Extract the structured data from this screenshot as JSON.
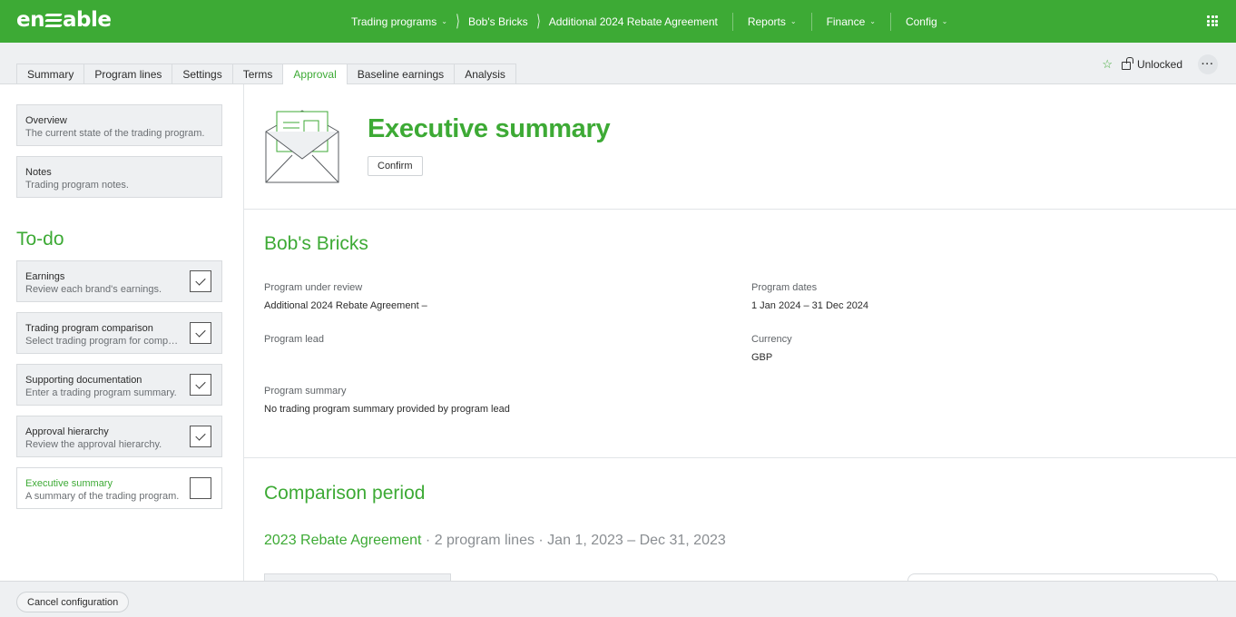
{
  "brand": {
    "logo_text_left": "en",
    "logo_text_right": "able"
  },
  "nav": {
    "trading_programs": "Trading programs",
    "crumb_supplier": "Bob's Bricks",
    "crumb_agreement": "Additional 2024 Rebate Agreement",
    "reports": "Reports",
    "finance": "Finance",
    "config": "Config"
  },
  "tabs": [
    {
      "label": "Summary"
    },
    {
      "label": "Program lines"
    },
    {
      "label": "Settings"
    },
    {
      "label": "Terms"
    },
    {
      "label": "Approval"
    },
    {
      "label": "Baseline earnings"
    },
    {
      "label": "Analysis"
    }
  ],
  "active_tab": "Approval",
  "lock_status": "Unlocked",
  "sidebar": {
    "overview": {
      "title": "Overview",
      "subtitle": "The current state of the trading program."
    },
    "notes": {
      "title": "Notes",
      "subtitle": "Trading program notes."
    },
    "todo_title": "To-do",
    "todo_items": [
      {
        "title": "Earnings",
        "subtitle": "Review each brand's earnings.",
        "checked": true
      },
      {
        "title": "Trading program comparison",
        "subtitle": "Select trading program for comparison.",
        "checked": true
      },
      {
        "title": "Supporting documentation",
        "subtitle": "Enter a trading program summary.",
        "checked": true
      },
      {
        "title": "Approval hierarchy",
        "subtitle": "Review the approval hierarchy.",
        "checked": true
      },
      {
        "title": "Executive summary",
        "subtitle": "A summary of the trading program.",
        "checked": false
      }
    ]
  },
  "main": {
    "title": "Executive summary",
    "confirm_label": "Confirm",
    "supplier_name": "Bob's Bricks",
    "fields": {
      "program_under_review_label": "Program under review",
      "program_under_review_value": "Additional 2024 Rebate Agreement –",
      "program_dates_label": "Program dates",
      "program_dates_value": "1 Jan 2024 – 31 Dec 2024",
      "program_lead_label": "Program lead",
      "program_lead_value": "",
      "currency_label": "Currency",
      "currency_value": "GBP",
      "program_summary_label": "Program summary",
      "program_summary_value": "No trading program summary provided by program lead"
    },
    "comparison_title": "Comparison period",
    "comparison_program": "2023 Rebate Agreement",
    "comparison_details": " · 2 program lines · Jan 1, 2023 – Dec 31, 2023"
  },
  "footer": {
    "cancel_label": "Cancel configuration"
  },
  "colors": {
    "brand_green": "#3daa35",
    "panel_grey": "#eef0f2",
    "border": "#d8dbde"
  },
  "icons": {
    "star": "star-icon",
    "lock": "unlock-icon",
    "more": "more-horizontal-icon",
    "apps": "apps-grid-icon",
    "envelope": "envelope-illustration-icon"
  }
}
